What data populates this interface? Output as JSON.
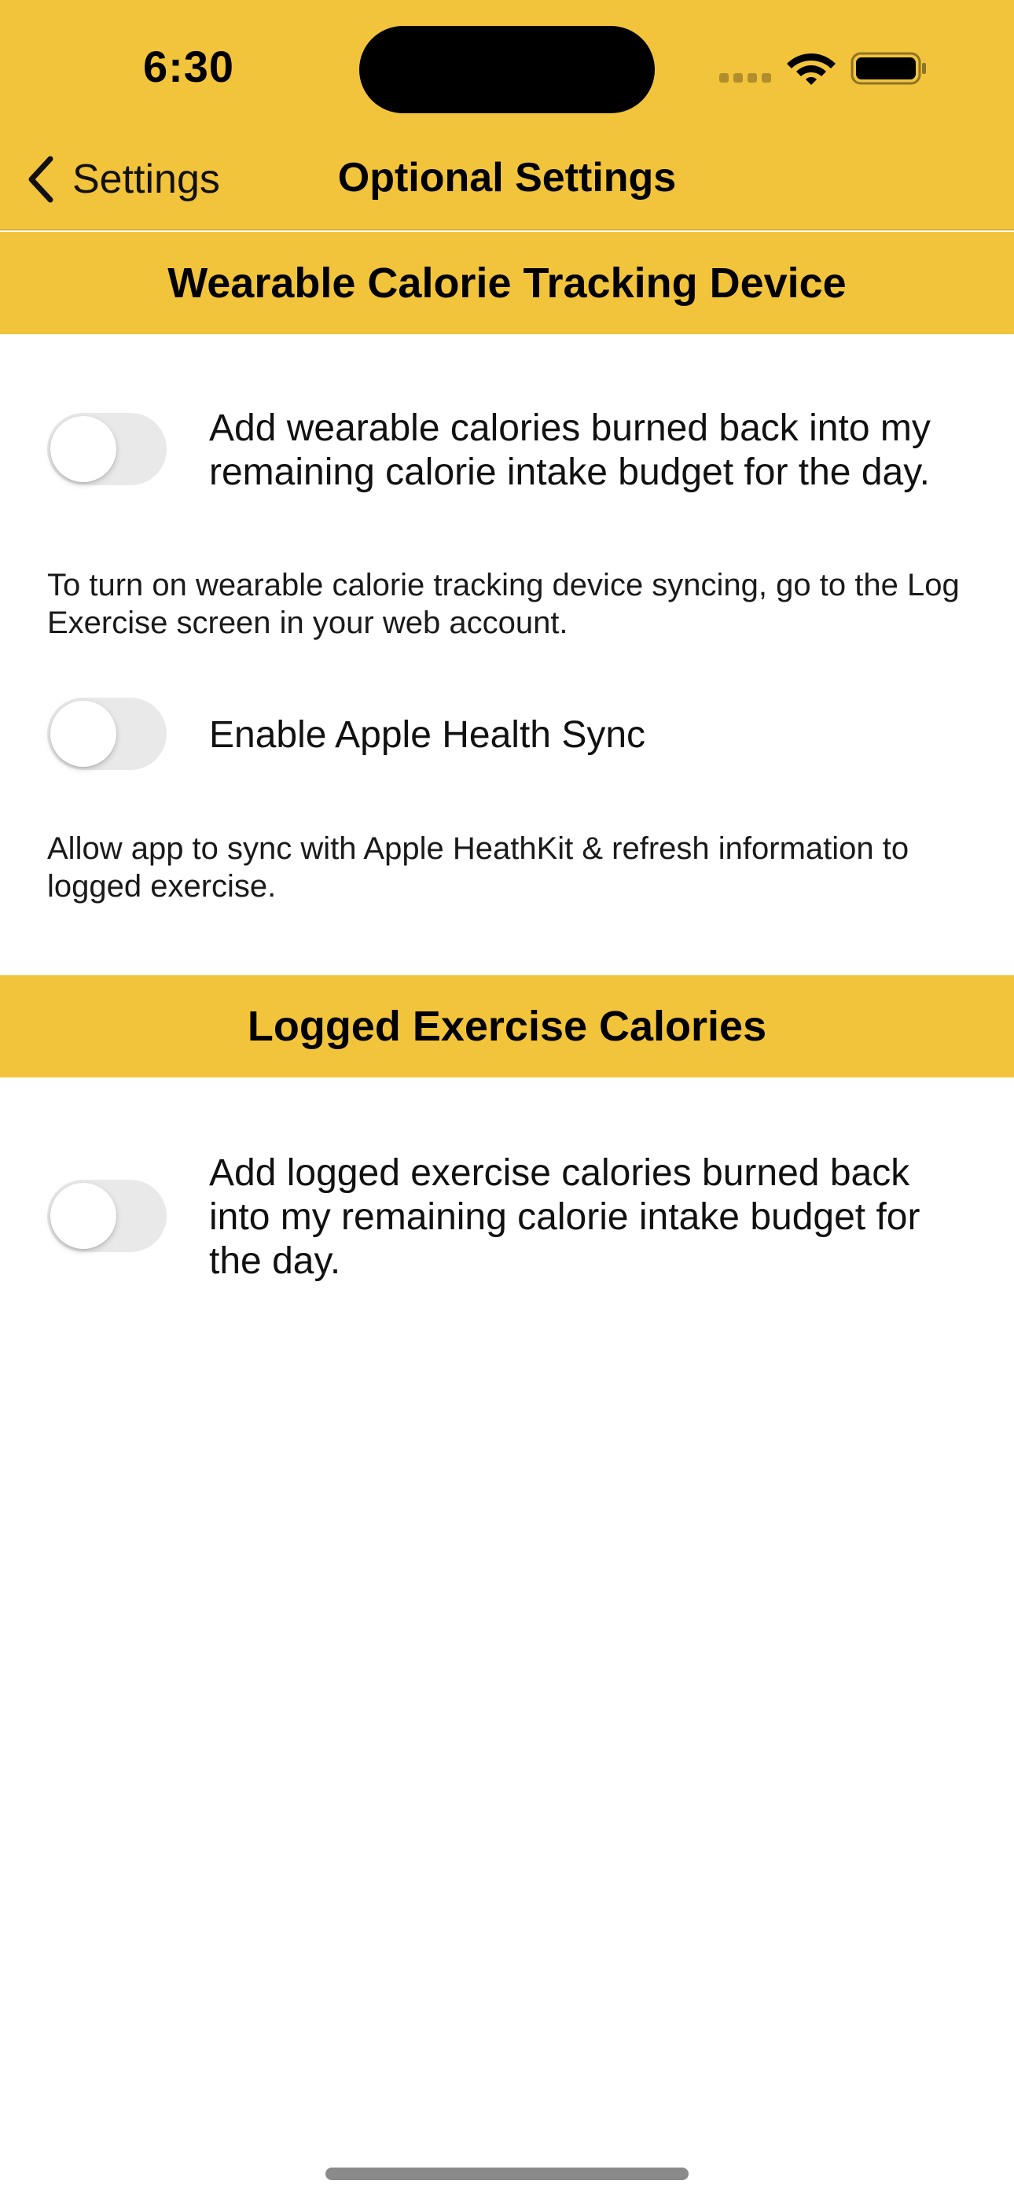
{
  "status_bar": {
    "time": "6:30",
    "icons": [
      "cellular-signal-icon",
      "wifi-icon",
      "battery-icon"
    ]
  },
  "nav": {
    "back_label": "Settings",
    "title": "Optional Settings"
  },
  "sections": [
    {
      "header": "Wearable Calorie Tracking Device",
      "rows": [
        {
          "label": "Add wearable calories burned back into my remaining calorie intake budget for the day.",
          "enabled": false,
          "help": "To turn on wearable calorie tracking device syncing, go to the Log Exercise screen in your web account."
        },
        {
          "label": "Enable Apple Health Sync",
          "enabled": false,
          "help": "Allow app to sync with Apple HeathKit & refresh information to logged exercise."
        }
      ]
    },
    {
      "header": "Logged Exercise Calories",
      "rows": [
        {
          "label": "Add logged exercise calories burned back into my remaining calorie intake budget for the day.",
          "enabled": false
        }
      ]
    }
  ],
  "colors": {
    "accent": "#F2C43C",
    "toggle_off": "#E9E9EA"
  }
}
